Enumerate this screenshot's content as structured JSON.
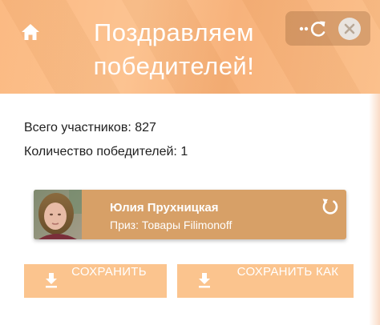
{
  "header": {
    "title": "Поздравляем победителей!",
    "home_icon": "home-icon",
    "reload_icon": "reload-icon",
    "close_icon": "close-icon"
  },
  "stats": {
    "total_participants": "Всего участников: 827",
    "winners_count": "Количество победителей: 1"
  },
  "winners": [
    {
      "name": "Юлия Прухницкая",
      "prize": "Приз: Товары Filimonoff",
      "action_icon": "redo-icon"
    }
  ],
  "actions": {
    "save_text": "СОХРАНИТЬ\nКАК ТЕКСТ",
    "save_image": "СОХРАНИТЬ КАК\nИЗОБРАЖЕНИЕ",
    "save_icon": "download-icon"
  },
  "colors": {
    "header": "#fbb67c",
    "card": "#d7a067",
    "button": "#fbc48e"
  }
}
